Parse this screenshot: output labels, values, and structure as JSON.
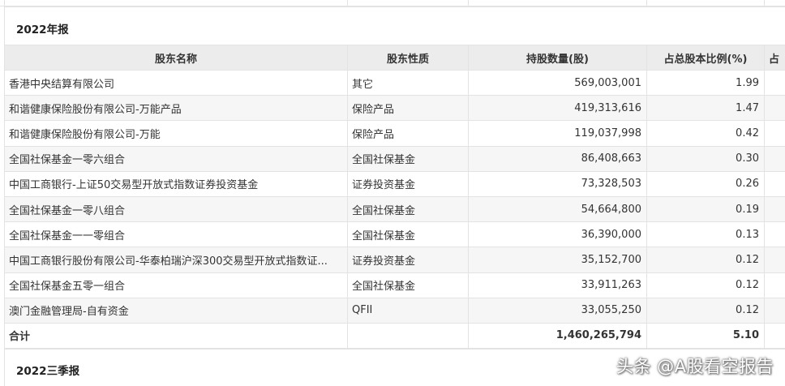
{
  "section_2022_annual": {
    "title": "2022年报"
  },
  "table": {
    "headers": [
      "股东名称",
      "股东性质",
      "持股数量(股)",
      "占总股本比例(%)",
      "占"
    ],
    "rows": [
      [
        "香港中央结算有限公司",
        "其它",
        "569,003,001",
        "1.99"
      ],
      [
        "和谐健康保险股份有限公司-万能产品",
        "保险产品",
        "419,313,616",
        "1.47"
      ],
      [
        "和谐健康保险股份有限公司-万能",
        "保险产品",
        "119,037,998",
        "0.42"
      ],
      [
        "全国社保基金一零六组合",
        "全国社保基金",
        "86,408,663",
        "0.30"
      ],
      [
        "中国工商银行-上证50交易型开放式指数证券投资基金",
        "证券投资基金",
        "73,328,503",
        "0.26"
      ],
      [
        "全国社保基金一零八组合",
        "全国社保基金",
        "54,664,800",
        "0.19"
      ],
      [
        "全国社保基金一一零组合",
        "全国社保基金",
        "36,390,000",
        "0.13"
      ],
      [
        "中国工商银行股份有限公司-华泰柏瑞沪深300交易型开放式指数证...",
        "证券投资基金",
        "35,152,700",
        "0.12"
      ],
      [
        "全国社保基金五零一组合",
        "全国社保基金",
        "33,911,263",
        "0.12"
      ],
      [
        "澳门金融管理局-自有资金",
        "QFII",
        "33,055,250",
        "0.12"
      ]
    ],
    "total": {
      "label": "合计",
      "shares": "1,460,265,794",
      "pct": "5.10"
    }
  },
  "section_2022_q3": {
    "title": "2022三季报"
  },
  "watermark": "头条 @A股看空报告"
}
